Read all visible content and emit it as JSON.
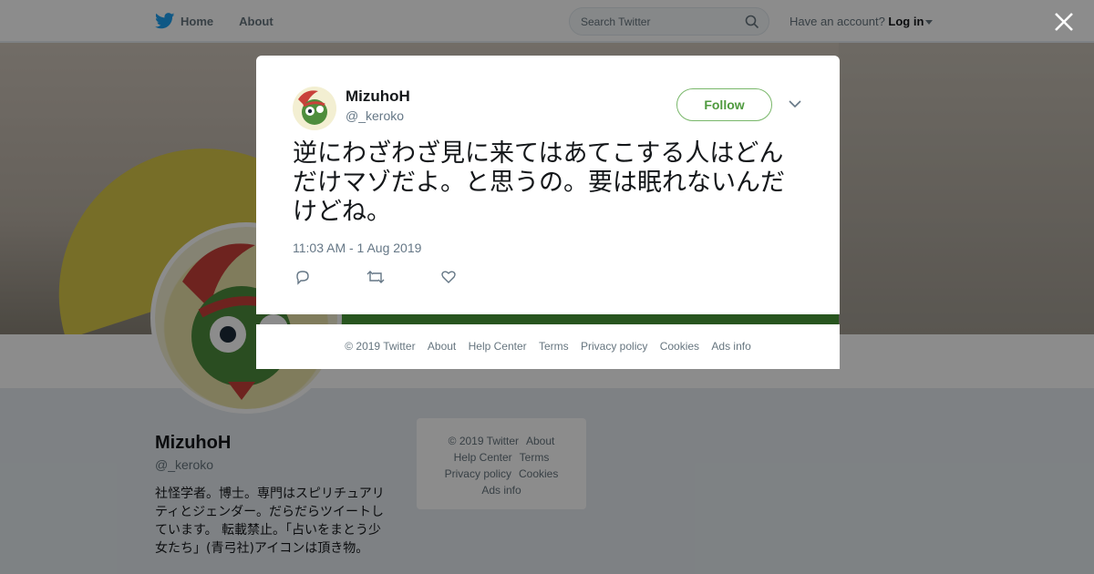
{
  "nav": {
    "home_label": "Home",
    "about_label": "About",
    "search_placeholder": "Search Twitter",
    "account_prompt": "Have an account?",
    "login_label": "Log in"
  },
  "profile": {
    "name": "MizuhoH",
    "handle": "@_keroko",
    "bio": "社怪学者。博士。専門はスピリチュアリティとジェンダー。だらだらツイートしています。 転載禁止。「占いをまとう少女たち」(青弓社)アイコンは頂き物。"
  },
  "side_footer": {
    "copyright": "© 2019 Twitter",
    "about": "About",
    "help": "Help Center",
    "terms": "Terms",
    "privacy": "Privacy policy",
    "cookies": "Cookies",
    "ads": "Ads info"
  },
  "tweet": {
    "author_name": "MizuhoH",
    "author_handle": "@_keroko",
    "follow_label": "Follow",
    "text": "逆にわざわざ見に来てはあてこする人はどんだけマゾだよ。と思うの。要は眠れないんだけどね。",
    "timestamp": "11:03 AM - 1 Aug 2019"
  },
  "modal_footer": {
    "copyright": "© 2019 Twitter",
    "about": "About",
    "help": "Help Center",
    "terms": "Terms",
    "privacy": "Privacy policy",
    "cookies": "Cookies",
    "ads": "Ads info"
  },
  "colors": {
    "twitter_blue": "#1da1f2",
    "follow_green": "#4f9a3f",
    "overlay": "rgba(0,0,0,0.45)"
  },
  "icons": [
    "twitter-bird-icon",
    "search-icon",
    "close-icon",
    "chevron-down-icon",
    "reply-icon",
    "retweet-icon",
    "like-icon"
  ]
}
